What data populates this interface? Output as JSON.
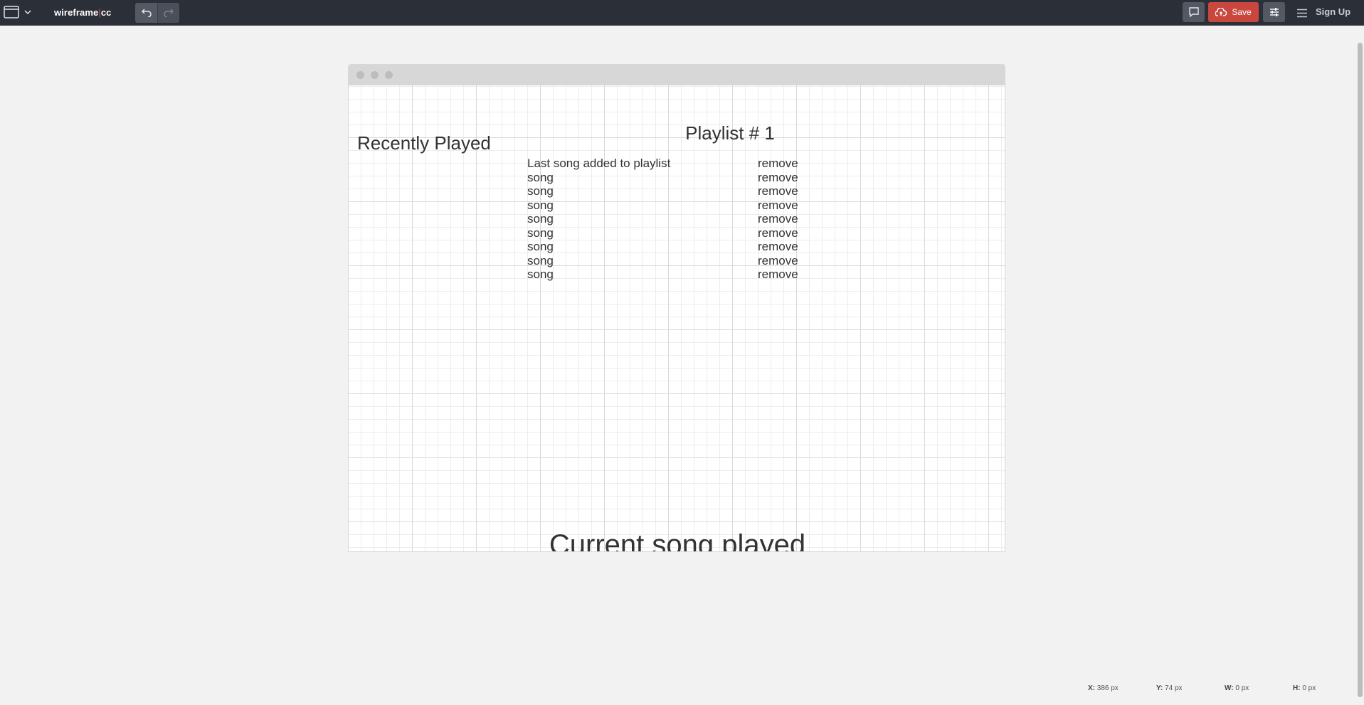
{
  "topbar": {
    "brand_left": "wireframe",
    "brand_sep": "|",
    "brand_right": "cc",
    "save_label": "Save",
    "signup_label": "Sign Up",
    "icons": {
      "document": "browser-window-icon",
      "chevron": "chevron-down-icon",
      "undo": "undo-icon",
      "redo": "redo-icon",
      "comment": "comment-icon",
      "save": "cloud-upload-icon",
      "settings": "sliders-icon",
      "menu": "hamburger-menu-icon"
    }
  },
  "canvas": {
    "recent_title": "Recently Played",
    "playlist_title": "Playlist # 1",
    "songs": [
      {
        "name": "Last song added to playlist",
        "action": "remove"
      },
      {
        "name": "song",
        "action": "remove"
      },
      {
        "name": "song",
        "action": "remove"
      },
      {
        "name": "song",
        "action": "remove"
      },
      {
        "name": "song",
        "action": "remove"
      },
      {
        "name": "song",
        "action": "remove"
      },
      {
        "name": "song",
        "action": "remove"
      },
      {
        "name": "song",
        "action": "remove"
      },
      {
        "name": "song",
        "action": "remove"
      }
    ],
    "current_song": "Current song played"
  },
  "status": {
    "x_label": "X:",
    "x_value": "386 px",
    "y_label": "Y:",
    "y_value": "74 px",
    "w_label": "W:",
    "w_value": "0 px",
    "h_label": "H:",
    "h_value": "0 px"
  },
  "colors": {
    "topbar_bg": "#2b2f38",
    "save_bg": "#c9473f",
    "page_bg": "#f2f2f2",
    "brand_separator": "#d9534f"
  }
}
